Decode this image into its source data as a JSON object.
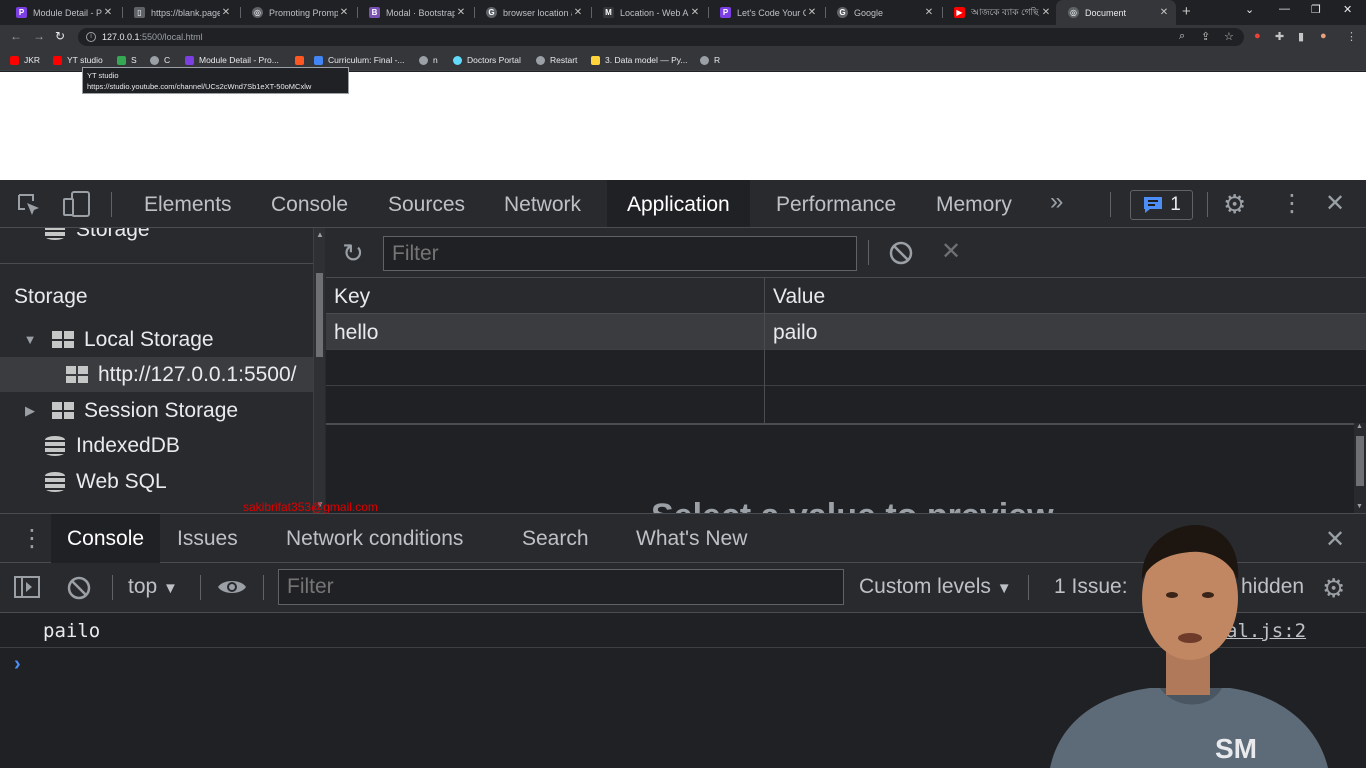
{
  "tabs": [
    {
      "title": "Module Detail - Pr",
      "favicon_letter": "P",
      "color": "#7b3fe4"
    },
    {
      "title": "https://blank.page",
      "favicon_letter": "▯",
      "color": "#5f6368"
    },
    {
      "title": "Promoting Prompt",
      "favicon_letter": "◎",
      "color": "#5f6368"
    },
    {
      "title": "Modal · Bootstrap",
      "favicon_letter": "B",
      "color": "#7952b3"
    },
    {
      "title": "browser location a",
      "favicon_letter": "G",
      "color": "#5f6368"
    },
    {
      "title": "Location - Web AP",
      "favicon_letter": "M",
      "color": "#35363a"
    },
    {
      "title": "Let's Code Your Ca",
      "favicon_letter": "P",
      "color": "#7b3fe4"
    },
    {
      "title": "Google",
      "favicon_letter": "G",
      "color": "#5f6368"
    },
    {
      "title": "আজকে ব্যাক গেছি ল",
      "favicon_letter": "▶",
      "color": "#ff0000"
    },
    {
      "title": "Document",
      "favicon_letter": "◎",
      "color": "#5f6368"
    }
  ],
  "address": {
    "host": "127.0.0.1",
    "path": ":5500/local.html"
  },
  "bookmarks": [
    {
      "label": "JKR",
      "color": "#ff0000"
    },
    {
      "label": "YT studio",
      "color": "#ff0000"
    },
    {
      "label": "S",
      "color": "#34a853"
    },
    {
      "label": "C",
      "color": "#9aa0a6"
    },
    {
      "label": "Module Detail - Pro...",
      "color": "#7b3fe4"
    },
    {
      "label": "",
      "color": "#ff5722"
    },
    {
      "label": "Curriculum: Final -...",
      "color": "#4285f4"
    },
    {
      "label": "n",
      "color": "#9aa0a6"
    },
    {
      "label": "Doctors Portal",
      "color": "#61dafb"
    },
    {
      "label": "Restart",
      "color": "#9aa0a6"
    },
    {
      "label": "3. Data model — Py...",
      "color": "#ffd43b"
    },
    {
      "label": "R",
      "color": "#9aa0a6"
    }
  ],
  "tooltip": {
    "title": "YT studio",
    "url": "https://studio.youtube.com/channel/UCs2cWnd7Sb1eXT-50oMCxlw"
  },
  "devtools": {
    "tabs": [
      "Elements",
      "Console",
      "Sources",
      "Network",
      "Application",
      "Performance",
      "Memory"
    ],
    "active_tab": "Application",
    "issues_count": "1"
  },
  "sidebar": {
    "cut_item": "Storage",
    "section": "Storage",
    "items": [
      {
        "label": "Local Storage",
        "expanded": "▼"
      },
      {
        "label": "http://127.0.0.1:5500/"
      },
      {
        "label": "Session Storage",
        "expanded": "▶"
      },
      {
        "label": "IndexedDB"
      },
      {
        "label": "Web SQL"
      }
    ]
  },
  "storage": {
    "filter_placeholder": "Filter",
    "columns": {
      "key": "Key",
      "value": "Value"
    },
    "rows": [
      {
        "key": "hello",
        "value": "pailo"
      }
    ],
    "preview_text": "Select a value to preview"
  },
  "watermark": "sakibrifat353@gmail.com",
  "drawer": {
    "tabs": [
      "Console",
      "Issues",
      "Network conditions",
      "Search",
      "What's New"
    ],
    "active_tab": "Console"
  },
  "console": {
    "context": "top",
    "filter_placeholder": "Filter",
    "levels": "Custom levels",
    "issues": "1 Issue:",
    "hidden": "hidden",
    "log": {
      "message": "pailo",
      "source": "al.js:2"
    }
  }
}
